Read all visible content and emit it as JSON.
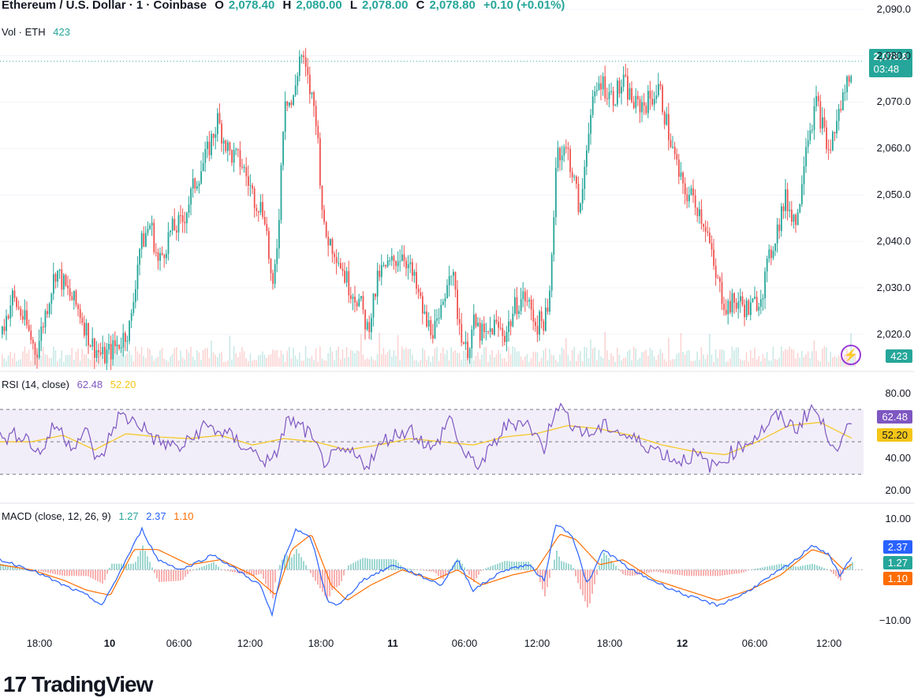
{
  "header": {
    "symbol": "Ethereum / U.S. Dollar · 1 · Coinbase",
    "ohlc": [
      {
        "label": "O",
        "value": "2,078.40"
      },
      {
        "label": "H",
        "value": "2,080.00"
      },
      {
        "label": "L",
        "value": "2,078.00"
      },
      {
        "label": "C",
        "value": "2,078.80"
      }
    ],
    "change": "+0.10 (+0.01%)"
  },
  "volume": {
    "label": "Vol · ETH",
    "value": "423"
  },
  "price_tag": {
    "price": "2,078.8",
    "countdown": "03:48"
  },
  "rsi": {
    "label": "RSI (14, close)",
    "value": "62.48",
    "ma": "52.20"
  },
  "macd": {
    "label": "MACD (close, 12, 26, 9)",
    "hist": "1.27",
    "macd": "2.37",
    "signal": "1.10"
  },
  "branding": "TradingView",
  "colors": {
    "up": "#26a69a",
    "down": "#ef5350",
    "rsi": "#7e57c2",
    "rsi_ma": "#f5c518",
    "macd": "#2962ff",
    "signal": "#ff6d00"
  },
  "chart_data": [
    {
      "type": "candlestick",
      "panel": "price",
      "ylim": [
        2013,
        2092
      ],
      "yticks": [
        "2,090.0",
        "2,080.0",
        "2,070.0",
        "2,060.0",
        "2,050.0",
        "2,040.0",
        "2,030.0",
        "2,020.0"
      ],
      "yvalues": [
        2090,
        2080,
        2070,
        2060,
        2050,
        2040,
        2030,
        2020
      ],
      "close_path": [
        [
          0,
          2020
        ],
        [
          15,
          2028
        ],
        [
          30,
          2023
        ],
        [
          45,
          2016
        ],
        [
          60,
          2027
        ],
        [
          70,
          2034
        ],
        [
          85,
          2029
        ],
        [
          100,
          2025
        ],
        [
          115,
          2018
        ],
        [
          130,
          2015
        ],
        [
          150,
          2018
        ],
        [
          165,
          2022
        ],
        [
          175,
          2038
        ],
        [
          190,
          2044
        ],
        [
          200,
          2035
        ],
        [
          215,
          2042
        ],
        [
          230,
          2044
        ],
        [
          245,
          2052
        ],
        [
          260,
          2058
        ],
        [
          275,
          2066
        ],
        [
          290,
          2059
        ],
        [
          305,
          2057
        ],
        [
          320,
          2050
        ],
        [
          335,
          2046
        ],
        [
          345,
          2028
        ],
        [
          352,
          2043
        ],
        [
          360,
          2072
        ],
        [
          370,
          2069
        ],
        [
          380,
          2081
        ],
        [
          390,
          2074
        ],
        [
          400,
          2067
        ],
        [
          410,
          2042
        ],
        [
          425,
          2038
        ],
        [
          440,
          2031
        ],
        [
          455,
          2027
        ],
        [
          465,
          2021
        ],
        [
          480,
          2033
        ],
        [
          495,
          2035
        ],
        [
          510,
          2038
        ],
        [
          525,
          2031
        ],
        [
          540,
          2022
        ],
        [
          555,
          2021
        ],
        [
          570,
          2036
        ],
        [
          580,
          2024
        ],
        [
          590,
          2016
        ],
        [
          600,
          2022
        ],
        [
          615,
          2019
        ],
        [
          625,
          2022
        ],
        [
          640,
          2020
        ],
        [
          655,
          2027
        ],
        [
          665,
          2028
        ],
        [
          680,
          2022
        ],
        [
          695,
          2024
        ],
        [
          705,
          2060
        ],
        [
          720,
          2059
        ],
        [
          735,
          2046
        ],
        [
          745,
          2065
        ],
        [
          760,
          2075
        ],
        [
          775,
          2071
        ],
        [
          790,
          2074
        ],
        [
          805,
          2069
        ],
        [
          820,
          2070
        ],
        [
          835,
          2073
        ],
        [
          850,
          2061
        ],
        [
          865,
          2051
        ],
        [
          880,
          2049
        ],
        [
          895,
          2043
        ],
        [
          905,
          2033
        ],
        [
          920,
          2026
        ],
        [
          935,
          2027
        ],
        [
          950,
          2025
        ],
        [
          965,
          2029
        ],
        [
          980,
          2040
        ],
        [
          995,
          2049
        ],
        [
          1010,
          2044
        ],
        [
          1020,
          2061
        ],
        [
          1035,
          2070
        ],
        [
          1050,
          2059
        ],
        [
          1065,
          2069
        ],
        [
          1080,
          2078.8
        ]
      ]
    },
    {
      "type": "bar",
      "panel": "volume",
      "series": [
        {
          "name": "Vol · ETH",
          "latest": 423
        }
      ]
    },
    {
      "type": "line",
      "panel": "rsi",
      "ylim": [
        15,
        90
      ],
      "yticks": [
        "80.00",
        "40.00",
        "20.00"
      ],
      "yvalues": [
        80,
        40,
        20
      ],
      "band": [
        30,
        70
      ],
      "midline": 50,
      "series": [
        {
          "name": "RSI",
          "points": [
            [
              0,
              52
            ],
            [
              30,
              55
            ],
            [
              50,
              42
            ],
            [
              70,
              61
            ],
            [
              90,
              48
            ],
            [
              110,
              56
            ],
            [
              125,
              36
            ],
            [
              150,
              66
            ],
            [
              175,
              62
            ],
            [
              200,
              50
            ],
            [
              230,
              46
            ],
            [
              260,
              60
            ],
            [
              290,
              54
            ],
            [
              320,
              44
            ],
            [
              345,
              36
            ],
            [
              365,
              64
            ],
            [
              390,
              56
            ],
            [
              410,
              38
            ],
            [
              440,
              44
            ],
            [
              465,
              36
            ],
            [
              490,
              52
            ],
            [
              520,
              58
            ],
            [
              550,
              44
            ],
            [
              570,
              66
            ],
            [
              590,
              40
            ],
            [
              610,
              36
            ],
            [
              640,
              59
            ],
            [
              665,
              64
            ],
            [
              690,
              46
            ],
            [
              705,
              74
            ],
            [
              725,
              62
            ],
            [
              745,
              54
            ],
            [
              770,
              60
            ],
            [
              800,
              52
            ],
            [
              830,
              46
            ],
            [
              860,
              38
            ],
            [
              880,
              42
            ],
            [
              905,
              34
            ],
            [
              930,
              44
            ],
            [
              960,
              54
            ],
            [
              985,
              66
            ],
            [
              1010,
              58
            ],
            [
              1030,
              72
            ],
            [
              1050,
              54
            ],
            [
              1065,
              46
            ],
            [
              1080,
              62.48
            ]
          ]
        },
        {
          "name": "RSI MA",
          "points": [
            [
              0,
              50
            ],
            [
              40,
              50
            ],
            [
              80,
              54
            ],
            [
              120,
              45
            ],
            [
              160,
              55
            ],
            [
              200,
              53
            ],
            [
              240,
              52
            ],
            [
              280,
              54
            ],
            [
              320,
              48
            ],
            [
              360,
              52
            ],
            [
              400,
              50
            ],
            [
              440,
              45
            ],
            [
              480,
              48
            ],
            [
              520,
              52
            ],
            [
              560,
              50
            ],
            [
              600,
              48
            ],
            [
              640,
              53
            ],
            [
              680,
              55
            ],
            [
              720,
              60
            ],
            [
              760,
              58
            ],
            [
              800,
              54
            ],
            [
              840,
              48
            ],
            [
              880,
              44
            ],
            [
              920,
              42
            ],
            [
              960,
              50
            ],
            [
              1000,
              60
            ],
            [
              1040,
              62
            ],
            [
              1080,
              52.2
            ]
          ]
        }
      ]
    },
    {
      "type": "line",
      "panel": "macd",
      "ylim": [
        -12,
        12
      ],
      "yticks": [
        "10.00",
        "−10.00"
      ],
      "yvalues": [
        10,
        -10
      ],
      "series": [
        {
          "name": "MACD",
          "points": [
            [
              0,
              2
            ],
            [
              40,
              0
            ],
            [
              80,
              -3
            ],
            [
              110,
              -5
            ],
            [
              130,
              -7
            ],
            [
              150,
              -1
            ],
            [
              180,
              8
            ],
            [
              200,
              2
            ],
            [
              230,
              0
            ],
            [
              270,
              3
            ],
            [
              300,
              0
            ],
            [
              330,
              -3
            ],
            [
              345,
              -9
            ],
            [
              360,
              2
            ],
            [
              375,
              8
            ],
            [
              395,
              6
            ],
            [
              415,
              -6
            ],
            [
              430,
              -7
            ],
            [
              460,
              -2
            ],
            [
              500,
              1
            ],
            [
              530,
              -1
            ],
            [
              560,
              -3
            ],
            [
              580,
              2
            ],
            [
              600,
              -4
            ],
            [
              640,
              0
            ],
            [
              670,
              1
            ],
            [
              690,
              -2
            ],
            [
              705,
              9
            ],
            [
              725,
              7
            ],
            [
              745,
              -3
            ],
            [
              765,
              4
            ],
            [
              800,
              0
            ],
            [
              840,
              -3
            ],
            [
              870,
              -5
            ],
            [
              910,
              -7
            ],
            [
              940,
              -5
            ],
            [
              980,
              -1
            ],
            [
              1010,
              2
            ],
            [
              1030,
              5
            ],
            [
              1050,
              3
            ],
            [
              1065,
              -1
            ],
            [
              1080,
              2.37
            ]
          ]
        },
        {
          "name": "Signal",
          "points": [
            [
              0,
              1
            ],
            [
              40,
              0
            ],
            [
              80,
              -2
            ],
            [
              110,
              -4
            ],
            [
              140,
              -5
            ],
            [
              170,
              4
            ],
            [
              200,
              4
            ],
            [
              240,
              1
            ],
            [
              280,
              2
            ],
            [
              320,
              -1
            ],
            [
              350,
              -5
            ],
            [
              370,
              4
            ],
            [
              395,
              7
            ],
            [
              420,
              -3
            ],
            [
              440,
              -6
            ],
            [
              470,
              -3
            ],
            [
              510,
              0
            ],
            [
              550,
              -2
            ],
            [
              580,
              0
            ],
            [
              610,
              -3
            ],
            [
              650,
              -1
            ],
            [
              680,
              0
            ],
            [
              710,
              7
            ],
            [
              730,
              6
            ],
            [
              760,
              1
            ],
            [
              790,
              2
            ],
            [
              830,
              -2
            ],
            [
              870,
              -4
            ],
            [
              910,
              -6
            ],
            [
              950,
              -4
            ],
            [
              990,
              -1
            ],
            [
              1030,
              4
            ],
            [
              1050,
              3
            ],
            [
              1070,
              0
            ],
            [
              1080,
              1.1
            ]
          ]
        }
      ]
    }
  ],
  "xaxis": [
    {
      "label": "18:00",
      "bold": false
    },
    {
      "label": "10",
      "bold": true
    },
    {
      "label": "06:00",
      "bold": false
    },
    {
      "label": "12:00",
      "bold": false
    },
    {
      "label": "18:00",
      "bold": false
    },
    {
      "label": "11",
      "bold": true
    },
    {
      "label": "06:00",
      "bold": false
    },
    {
      "label": "12:00",
      "bold": false
    },
    {
      "label": "18:00",
      "bold": false
    },
    {
      "label": "12",
      "bold": true
    },
    {
      "label": "06:00",
      "bold": false
    },
    {
      "label": "12:00",
      "bold": false
    }
  ]
}
